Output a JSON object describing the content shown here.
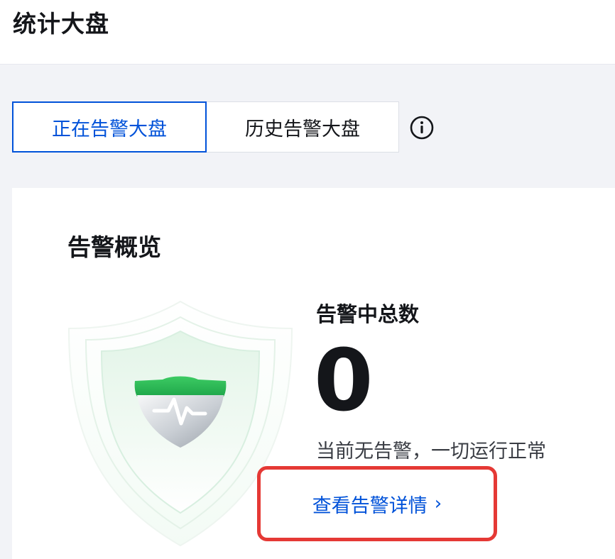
{
  "header": {
    "title": "统计大盘"
  },
  "tabs": [
    {
      "label": "正在告警大盘",
      "active": true
    },
    {
      "label": "历史告警大盘",
      "active": false
    }
  ],
  "info_icon": "info-circle-icon",
  "overview": {
    "title": "告警概览",
    "total_label": "告警中总数",
    "total_value": "0",
    "status_text": "当前无告警，一切运行正常",
    "detail_link": "查看告警详情",
    "detail_icon": "chevron-right-icon",
    "illustration_icon": "shield-heartbeat-icon"
  },
  "colors": {
    "accent": "#0052d9",
    "highlight_border": "#e53935",
    "shield_green": "#2fbf5a",
    "background": "#f2f3f7"
  }
}
